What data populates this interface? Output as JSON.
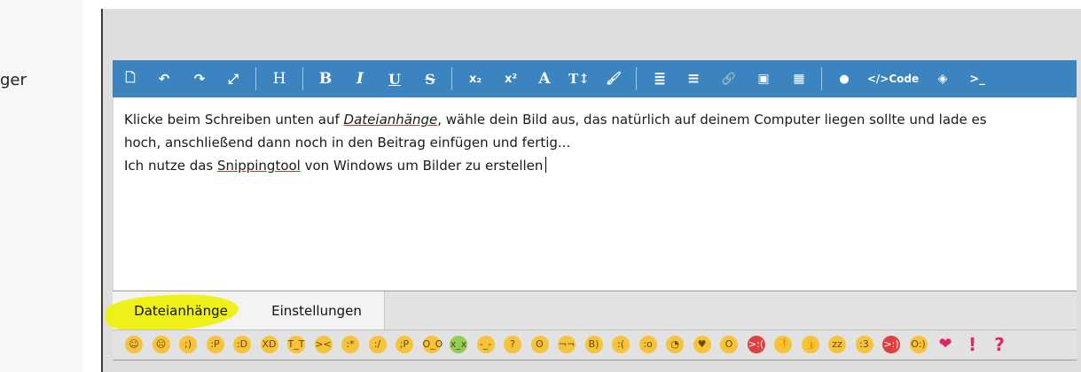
{
  "sidebar": {
    "partial_label": "ger"
  },
  "toolbar": {
    "items": [
      {
        "name": "source-icon",
        "glyph": "🗋"
      },
      {
        "name": "undo-icon",
        "glyph": "↶"
      },
      {
        "name": "redo-icon",
        "glyph": "↷"
      },
      {
        "name": "fullscreen-icon",
        "glyph": "⤢"
      },
      {
        "name": "heading-button",
        "glyph": "H"
      },
      {
        "name": "bold-button",
        "glyph": "B"
      },
      {
        "name": "italic-button",
        "glyph": "I"
      },
      {
        "name": "underline-button",
        "glyph": "U"
      },
      {
        "name": "strikethrough-button",
        "glyph": "S"
      },
      {
        "name": "subscript-button",
        "glyph": "x₂"
      },
      {
        "name": "superscript-button",
        "glyph": "x²"
      },
      {
        "name": "font-color-button",
        "glyph": "A"
      },
      {
        "name": "font-size-button",
        "glyph": "T↕"
      },
      {
        "name": "brush-icon",
        "glyph": "🖌"
      },
      {
        "name": "list-icon",
        "glyph": "≣"
      },
      {
        "name": "align-icon",
        "glyph": "≡"
      },
      {
        "name": "link-icon",
        "glyph": "🔗"
      },
      {
        "name": "image-icon",
        "glyph": "▣"
      },
      {
        "name": "table-icon",
        "glyph": "▦"
      },
      {
        "name": "quote-icon",
        "glyph": "●"
      },
      {
        "name": "code-button",
        "glyph": "</>Code"
      },
      {
        "name": "spoiler-icon",
        "glyph": "◈"
      },
      {
        "name": "terminal-icon",
        "glyph": ">_"
      }
    ]
  },
  "editor": {
    "line1_prefix": "Klicke beim Schreiben unten auf ",
    "line1_link": "Dateianhänge",
    "line1_suffix": ", wähle dein Bild aus, das natürlich auf deinem Computer liegen sollte und lade es",
    "line2": "hoch, anschließend dann noch in den Beitrag einfügen und fertig...",
    "line3_prefix": "Ich nutze das ",
    "line3_link": "Snippingtool",
    "line3_suffix": " von Windows um Bilder zu erstellen"
  },
  "tabs": {
    "attachments_label": "Dateianhänge",
    "settings_label": "Einstellungen"
  },
  "emojis": [
    {
      "name": "smile-emoji-icon",
      "glyph": "☺"
    },
    {
      "name": "sad-emoji-icon",
      "glyph": "☹"
    },
    {
      "name": "wink-emoji-icon",
      "glyph": ";)"
    },
    {
      "name": "tongue-emoji-icon",
      "glyph": ":P"
    },
    {
      "name": "grin-emoji-icon",
      "glyph": ":D"
    },
    {
      "name": "laugh-emoji-icon",
      "glyph": "XD"
    },
    {
      "name": "crying-emoji-icon",
      "glyph": "T_T"
    },
    {
      "name": "squint-emoji-icon",
      "glyph": "><"
    },
    {
      "name": "kiss-emoji-icon",
      "glyph": ":*"
    },
    {
      "name": "confused-emoji-icon",
      "glyph": ":/"
    },
    {
      "name": "crazy-emoji-icon",
      "glyph": ";P"
    },
    {
      "name": "shocked-emoji-icon",
      "glyph": "O_O"
    },
    {
      "name": "sick-emoji-icon",
      "glyph": "x_x"
    },
    {
      "name": "tired-emoji-icon",
      "glyph": "-_-"
    },
    {
      "name": "thinking-emoji-icon",
      "glyph": "?"
    },
    {
      "name": "upside-down-emoji-icon",
      "glyph": "ʘ"
    },
    {
      "name": "unamused-emoji-icon",
      "glyph": "¬¬"
    },
    {
      "name": "cool-emoji-icon",
      "glyph": "B)"
    },
    {
      "name": "worried-emoji-icon",
      "glyph": ":("
    },
    {
      "name": "surprised-emoji-icon",
      "glyph": ":o"
    },
    {
      "name": "eye-roll-emoji-icon",
      "glyph": "◔"
    },
    {
      "name": "heart-eyes-emoji-icon",
      "glyph": "♥"
    },
    {
      "name": "astonished-emoji-icon",
      "glyph": "O"
    },
    {
      "name": "angry-emoji-icon",
      "glyph": ">:("
    },
    {
      "name": "thumbs-down-icon",
      "glyph": "👎"
    },
    {
      "name": "thumbs-up-icon",
      "glyph": "👍"
    },
    {
      "name": "sleeping-emoji-icon",
      "glyph": "zz"
    },
    {
      "name": "whistle-emoji-icon",
      "glyph": ":3"
    },
    {
      "name": "devil-emoji-icon",
      "glyph": ">:)"
    },
    {
      "name": "angel-emoji-icon",
      "glyph": "O:)"
    },
    {
      "name": "heart-icon",
      "glyph": "❤"
    },
    {
      "name": "exclamation-icon",
      "glyph": "!"
    },
    {
      "name": "question-icon",
      "glyph": "?"
    }
  ],
  "colors": {
    "toolbar": "#3b84bf",
    "highlight": "#eef200",
    "emoji": "#f6c33b"
  }
}
